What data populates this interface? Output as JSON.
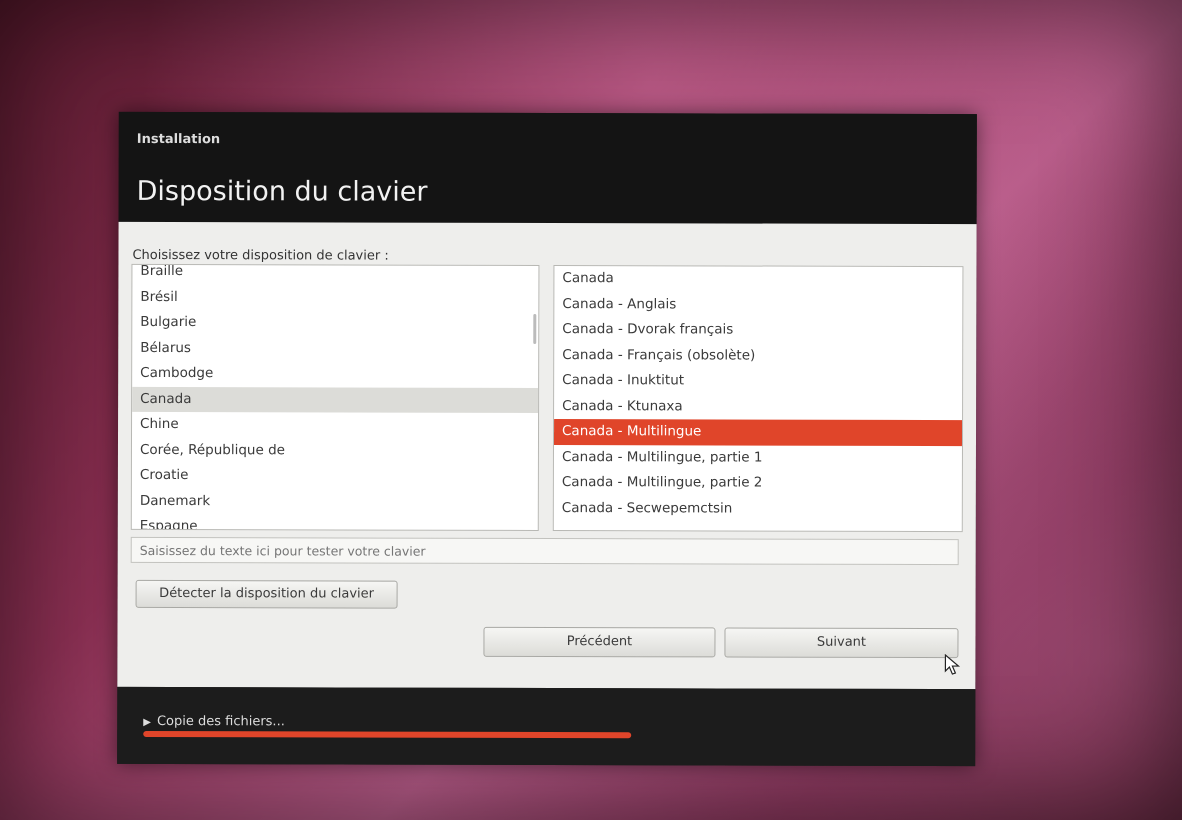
{
  "window": {
    "app_title": "Installation",
    "page_title": "Disposition du clavier"
  },
  "prompt": "Choisissez votre disposition de clavier :",
  "left_list": {
    "items": [
      "Braille",
      "Brésil",
      "Bulgarie",
      "Bélarus",
      "Cambodge",
      "Canada",
      "Chine",
      "Corée, République de",
      "Croatie",
      "Danemark",
      "Espagne"
    ],
    "selected": "Canada"
  },
  "right_list": {
    "items": [
      "Canada",
      "Canada - Anglais",
      "Canada - Dvorak français",
      "Canada - Français (obsolète)",
      "Canada - Inuktitut",
      "Canada - Ktunaxa",
      "Canada - Multilingue",
      "Canada - Multilingue, partie 1",
      "Canada - Multilingue, partie 2",
      "Canada - Secwepemctsin"
    ],
    "selected": "Canada - Multilingue"
  },
  "test_field": {
    "placeholder": "Saisissez du texte ici pour tester votre clavier"
  },
  "buttons": {
    "detect": "Détecter la disposition du clavier",
    "previous": "Précédent",
    "next": "Suivant"
  },
  "footer": {
    "status": "Copie des fichiers...",
    "progress": 0.61
  },
  "colors": {
    "accent": "#e0452a",
    "chrome": "#1c1c1c"
  }
}
